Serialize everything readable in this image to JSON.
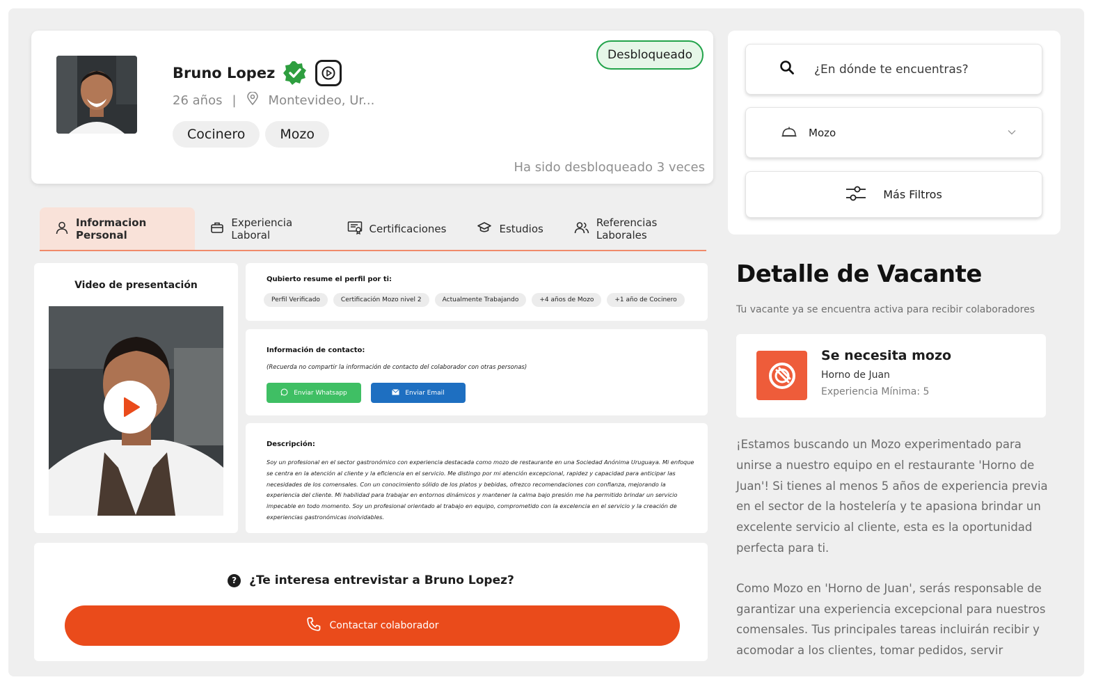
{
  "candidate": {
    "name": "Bruno Lopez",
    "age": "26 años",
    "separator": "|",
    "location": "Montevideo, Ur...",
    "roles": [
      "Cocinero",
      "Mozo"
    ],
    "status": "Desbloqueado",
    "unlock_count_text": "Ha sido desbloqueado 3 veces"
  },
  "tabs": [
    {
      "label": "Informacion Personal",
      "icon": "user-icon",
      "active": true
    },
    {
      "label": "Experiencia Laboral",
      "icon": "briefcase-icon",
      "active": false
    },
    {
      "label": "Certificaciones",
      "icon": "certificate-icon",
      "active": false
    },
    {
      "label": "Estudios",
      "icon": "graduation-cap-icon",
      "active": false
    },
    {
      "label": "Referencias Laborales",
      "icon": "users-icon",
      "active": false
    }
  ],
  "video": {
    "title": "Video de presentación"
  },
  "summary": {
    "heading": "Qubierto resume el perfil por ti:",
    "tags": [
      "Perfil Verificado",
      "Certificación Mozo nivel 2",
      "Actualmente Trabajando",
      "+4 años de Mozo",
      "+1 año de Cocinero"
    ]
  },
  "contact": {
    "heading": "Información de contacto:",
    "note": "(Recuerda no compartir la información de contacto del colaborador con otras personas)",
    "whatsapp_label": "Enviar Whatsapp",
    "email_label": "Enviar Email"
  },
  "description": {
    "heading": "Descripción:",
    "text": "Soy un profesional en el sector gastronómico con experiencia destacada como mozo de restaurante en una Sociedad Anónima Uruguaya. Mi enfoque se centra en la atención al cliente y la eficiencia en el servicio. Me distingo por mi atención excepcional, rapidez y capacidad para anticipar las necesidades de los comensales. Con un conocimiento sólido de los platos y bebidas, ofrezco recomendaciones con confianza, mejorando la experiencia del cliente. Mi habilidad para trabajar en entornos dinámicos y mantener la calma bajo presión me ha permitido brindar un servicio impecable en todo momento. Soy un profesional orientado al trabajo en equipo, comprometido con la excelencia en el servicio y la creación de experiencias gastronómicas inolvidables."
  },
  "interview": {
    "question": "¿Te interesa entrevistar a Bruno Lopez?",
    "button_label": "Contactar colaborador"
  },
  "filters": {
    "search_placeholder": "¿En dónde te encuentras?",
    "selected_role": "Mozo",
    "more_filters_label": "Más Filtros"
  },
  "vacancy": {
    "title": "Detalle de Vacante",
    "subtitle": "Tu vacante ya se encuentra activa para recibir colaboradores",
    "name": "Se necesita mozo",
    "company": "Horno de Juan",
    "experience": "Experiencia Mínima: 5",
    "paragraphs": [
      "¡Estamos buscando un Mozo experimentado para unirse a nuestro equipo en el restaurante 'Horno de Juan'! Si tienes al menos 5 años de experiencia previa en el sector de la hostelería y te apasiona brindar un excelente servicio al cliente, esta es la oportunidad perfecta para ti.",
      "Como Mozo en 'Horno de Juan', serás responsable de garantizar una experiencia excepcional para nuestros comensales. Tus principales tareas incluirán recibir y acomodar a los clientes, tomar pedidos, servir"
    ]
  },
  "colors": {
    "accent": "#ea4b1b",
    "verified": "#2e9e3f",
    "whatsapp": "#3fbf64",
    "email": "#1e6fc1",
    "tab_active_bg": "#f9e2d9"
  }
}
